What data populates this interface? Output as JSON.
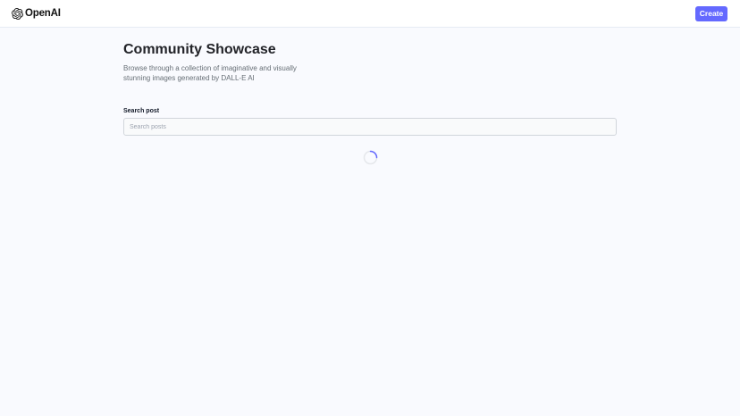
{
  "header": {
    "logo_text": "OpenAI",
    "create_label": "Create"
  },
  "main": {
    "title": "Community Showcase",
    "subtitle": "Browse through a collection of imaginative and visually stunning images generated by DALL-E AI",
    "search": {
      "label": "Search post",
      "placeholder": "Search posts",
      "value": ""
    },
    "loading": true
  },
  "icons": {
    "logo": "openai-logo-icon",
    "loader": "spinner-icon"
  },
  "colors": {
    "accent": "#6469ff",
    "background": "#f9fafe",
    "header_bg": "#ffffff",
    "title": "#222328",
    "subtitle": "#666e75"
  }
}
